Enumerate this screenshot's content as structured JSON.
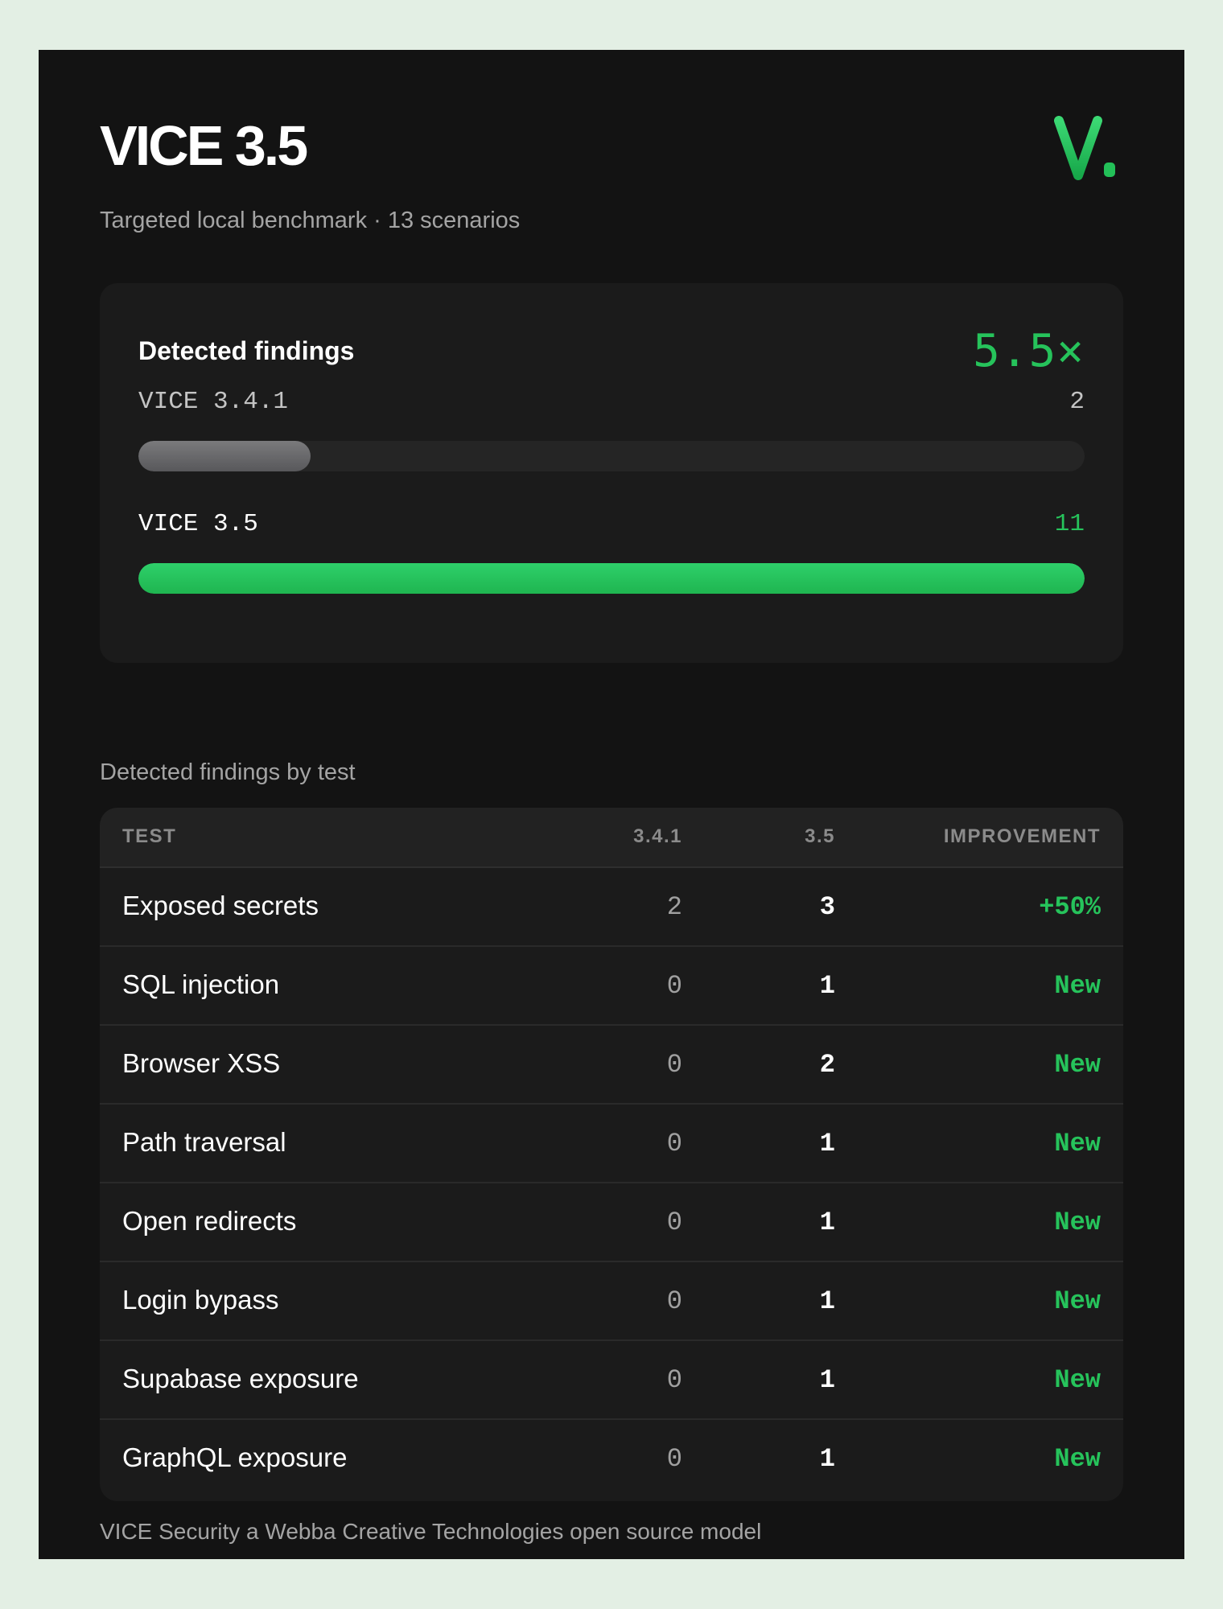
{
  "header": {
    "title": "VICE 3.5",
    "subtitle": "Targeted local benchmark · 13 scenarios",
    "logo_icon": "vice-v-logo"
  },
  "summary": {
    "label": "Detected findings",
    "ratio": "5.5×",
    "max_value": 11,
    "rows": [
      {
        "label": "VICE 3.4.1",
        "value": "2",
        "count": 2
      },
      {
        "label": "VICE 3.5",
        "value": "11",
        "count": 11
      }
    ]
  },
  "table": {
    "section_label": "Detected findings by test",
    "headers": {
      "test": "TEST",
      "old": "3.4.1",
      "new": "3.5",
      "improvement": "IMPROVEMENT"
    },
    "rows": [
      {
        "test": "Exposed secrets",
        "old": "2",
        "new": "3",
        "improvement": "+50%"
      },
      {
        "test": "SQL injection",
        "old": "0",
        "new": "1",
        "improvement": "New"
      },
      {
        "test": "Browser XSS",
        "old": "0",
        "new": "2",
        "improvement": "New"
      },
      {
        "test": "Path traversal",
        "old": "0",
        "new": "1",
        "improvement": "New"
      },
      {
        "test": "Open redirects",
        "old": "0",
        "new": "1",
        "improvement": "New"
      },
      {
        "test": "Login bypass",
        "old": "0",
        "new": "1",
        "improvement": "New"
      },
      {
        "test": "Supabase exposure",
        "old": "0",
        "new": "1",
        "improvement": "New"
      },
      {
        "test": "GraphQL exposure",
        "old": "0",
        "new": "1",
        "improvement": "New"
      }
    ]
  },
  "footer": {
    "text": "VICE Security a Webba Creative Technologies open source model"
  },
  "colors": {
    "background": "#e3efe4",
    "card": "#131313",
    "panel": "#1b1b1b",
    "accent": "#26c35b",
    "muted_bar": "#6a6a6c"
  }
}
